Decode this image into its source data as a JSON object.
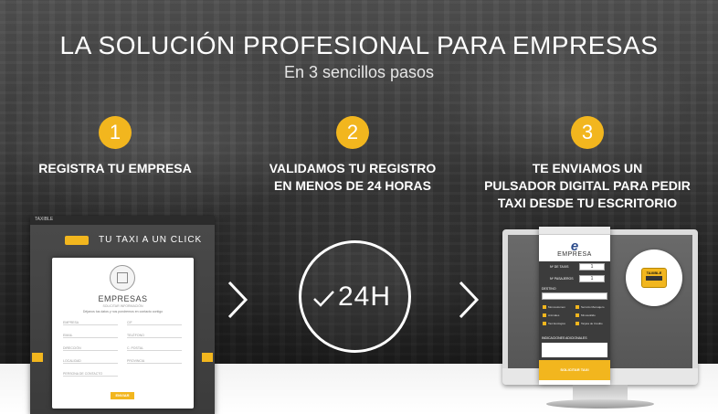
{
  "hero": {
    "title": "LA SOLUCIÓN PROFESIONAL PARA EMPRESAS",
    "subtitle": "En 3 sencillos pasos"
  },
  "steps": [
    {
      "number": "1",
      "text_lines": [
        "REGISTRA TU EMPRESA"
      ]
    },
    {
      "number": "2",
      "text_lines": [
        "VALIDAMOS TU REGISTRO",
        "EN MENOS DE 24 HORAS"
      ]
    },
    {
      "number": "3",
      "text_lines": [
        "TE ENVIAMOS UN",
        "PULSADOR DIGITAL PARA PEDIR",
        "TAXI DESDE TU ESCRITORIO"
      ]
    }
  ],
  "badge": {
    "label": "24H",
    "icon": "check-icon"
  },
  "colors": {
    "accent": "#f2b61e",
    "text": "#ffffff",
    "floor": "#ffffff"
  },
  "left_screenshot": {
    "brand": "TAXIBLE",
    "hero": "TU TAXI A UN CLICK",
    "form_title": "EMPRESAS",
    "form_sub": "SOLICITAR INFORMACIÓN",
    "form_desc": "Déjanos tus datos y nos pondremos en contacto contigo",
    "fields": [
      "EMPRESA",
      "CIF",
      "EMAIL",
      "TELÉFONO",
      "DIRECCIÓN",
      "C. POSTAL",
      "LOCALIDAD",
      "PROVINCIA",
      "PERSONA DE CONTACTO"
    ],
    "send_label": "ENVIAR"
  },
  "app": {
    "logo": "e",
    "name": "EMPRESA",
    "rows": [
      {
        "label": "Nº DE TAXIS",
        "value": "1"
      },
      {
        "label": "Nº PASAJEROS",
        "value": "1"
      }
    ],
    "destination_label": "DESTINO",
    "options": [
      "Monovolumen",
      "Servicio Mensajero",
      "Animales",
      "Minusválido",
      "Taxi Ecológico",
      "Tarjeta de Crédito"
    ],
    "notes_label": "INDICACIONES ADICIONALES",
    "button_label": "SOLICITAR TAXI"
  },
  "taxi_sign": {
    "text": "TAXIBLE"
  }
}
